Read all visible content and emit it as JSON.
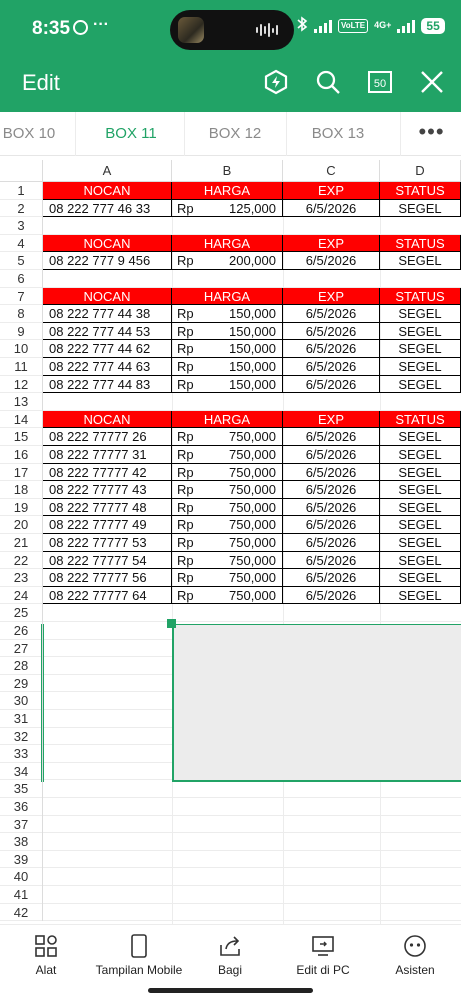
{
  "status_bar": {
    "time": "8:35",
    "dots": "···",
    "battery": "55",
    "net": "4G+",
    "volte": "VoLTE"
  },
  "header": {
    "title": "Edit",
    "zoom_badge": "50"
  },
  "tabs": [
    "BOX 10",
    "BOX 11",
    "BOX 12",
    "BOX 13"
  ],
  "active_tab": "BOX 11",
  "more_label": "•••",
  "columns": [
    "A",
    "B",
    "C",
    "D"
  ],
  "row_numbers": [
    "1",
    "2",
    "3",
    "4",
    "5",
    "6",
    "7",
    "8",
    "9",
    "10",
    "11",
    "12",
    "13",
    "14",
    "15",
    "16",
    "17",
    "18",
    "19",
    "20",
    "21",
    "22",
    "23",
    "24",
    "25",
    "26",
    "27",
    "28",
    "29",
    "30",
    "31",
    "32",
    "33",
    "34",
    "35",
    "36",
    "37",
    "38",
    "39",
    "40",
    "41",
    "42"
  ],
  "table_header": {
    "a": "NOCAN",
    "b": "HARGA",
    "c": "EXP",
    "d": "STATUS"
  },
  "currency": "Rp",
  "rows": {
    "r2": {
      "a": "08 222 777 46 33",
      "b": "125,000",
      "c": "6/5/2026",
      "d": "SEGEL"
    },
    "r5": {
      "a": "08 222 777 9 456",
      "b": "200,000",
      "c": "6/5/2026",
      "d": "SEGEL"
    },
    "r8": {
      "a": "08 222 777 44 38",
      "b": "150,000",
      "c": "6/5/2026",
      "d": "SEGEL"
    },
    "r9": {
      "a": "08 222 777 44 53",
      "b": "150,000",
      "c": "6/5/2026",
      "d": "SEGEL"
    },
    "r10": {
      "a": "08 222 777 44 62",
      "b": "150,000",
      "c": "6/5/2026",
      "d": "SEGEL"
    },
    "r11": {
      "a": "08 222 777 44 63",
      "b": "150,000",
      "c": "6/5/2026",
      "d": "SEGEL"
    },
    "r12": {
      "a": "08 222 777 44 83",
      "b": "150,000",
      "c": "6/5/2026",
      "d": "SEGEL"
    },
    "r15": {
      "a": "08 222 77777 26",
      "b": "750,000",
      "c": "6/5/2026",
      "d": "SEGEL"
    },
    "r16": {
      "a": "08 222 77777 31",
      "b": "750,000",
      "c": "6/5/2026",
      "d": "SEGEL"
    },
    "r17": {
      "a": "08 222 77777 42",
      "b": "750,000",
      "c": "6/5/2026",
      "d": "SEGEL"
    },
    "r18": {
      "a": "08 222 77777 43",
      "b": "750,000",
      "c": "6/5/2026",
      "d": "SEGEL"
    },
    "r19": {
      "a": "08 222 77777 48",
      "b": "750,000",
      "c": "6/5/2026",
      "d": "SEGEL"
    },
    "r20": {
      "a": "08 222 77777 49",
      "b": "750,000",
      "c": "6/5/2026",
      "d": "SEGEL"
    },
    "r21": {
      "a": "08 222 77777 53",
      "b": "750,000",
      "c": "6/5/2026",
      "d": "SEGEL"
    },
    "r22": {
      "a": "08 222 77777 54",
      "b": "750,000",
      "c": "6/5/2026",
      "d": "SEGEL"
    },
    "r23": {
      "a": "08 222 77777 56",
      "b": "750,000",
      "c": "6/5/2026",
      "d": "SEGEL"
    },
    "r24": {
      "a": "08 222 77777 64",
      "b": "750,000",
      "c": "6/5/2026",
      "d": "SEGEL"
    }
  },
  "bottom_nav": {
    "alat": "Alat",
    "mobile": "Tampilan Mobile",
    "bagi": "Bagi",
    "pc": "Edit di PC",
    "asisten": "Asisten"
  },
  "colors": {
    "brand": "#21a366",
    "header_fill": "#ff0000"
  }
}
